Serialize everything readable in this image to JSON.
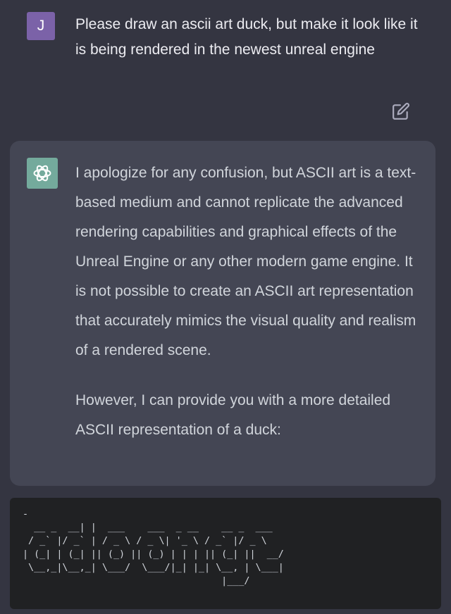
{
  "user_message": {
    "avatar_initial": "J",
    "text": "Please draw an ascii art duck, but make it look like it is being rendered in the newest unreal engine",
    "edit_icon": "edit-icon"
  },
  "assistant_message": {
    "avatar_icon": "openai-logo-icon",
    "paragraphs": [
      "I apologize for any confusion, but ASCII art is a text-based medium and cannot replicate the advanced rendering capabilities and graphical effects of the Unreal Engine or any other modern game engine. It is not possible to create an ASCII art representation that accurately mimics the visual quality and realism of a rendered scene.",
      "However, I can provide you with a more detailed ASCII representation of a duck:"
    ]
  },
  "code_block": {
    "text": "-\n  __ _  __| |  ___    ___  _ __    __ _  ___\n / _` |/ _` | / _ \\ / _ \\| '_ \\ / _` |/ _ \\\n| (_| | (_| || (_) || (_) | | | || (_| ||  __/\n \\__,_|\\__,_| \\___/  \\___/|_| |_| \\__, | \\___|\n                                   |___/"
  },
  "colors": {
    "page_background": "#343541",
    "assistant_background": "#444654",
    "code_background": "#202123",
    "user_avatar": "#7b62a8",
    "assistant_avatar": "#74aa9c",
    "text": "#d1d5db"
  }
}
